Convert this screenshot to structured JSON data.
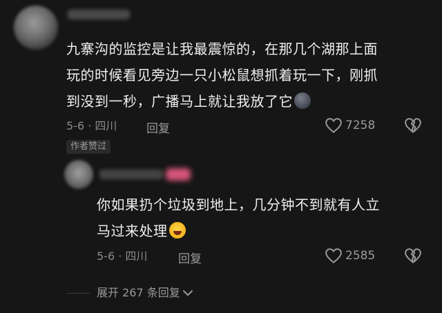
{
  "comment": {
    "text_lines": [
      "九寨沟的监控是让我最震惊的，在那几个湖那上面",
      "玩的时候看见旁边一只小松鼠想抓着玩一下，刚抓",
      "到没到一秒，广播马上就让我放了它"
    ],
    "date_location": "5-6 · 四川",
    "reply_label": "回复",
    "like_count": "7258",
    "badge": "作者赞过",
    "emoji_icon": "new-moon-face-icon"
  },
  "reply": {
    "text_lines": [
      "你如果扔个垃圾到地上，几分钟不到就有人立",
      "马过来处理"
    ],
    "date_location": "5-6 · 四川",
    "reply_label": "回复",
    "like_count": "2585",
    "emoji_icon": "rolling-laughing-face-icon"
  },
  "expand": {
    "label": "展开 267 条回复"
  },
  "colors": {
    "background": "#161616",
    "text": "#efefef",
    "meta": "#8a8a8a"
  }
}
